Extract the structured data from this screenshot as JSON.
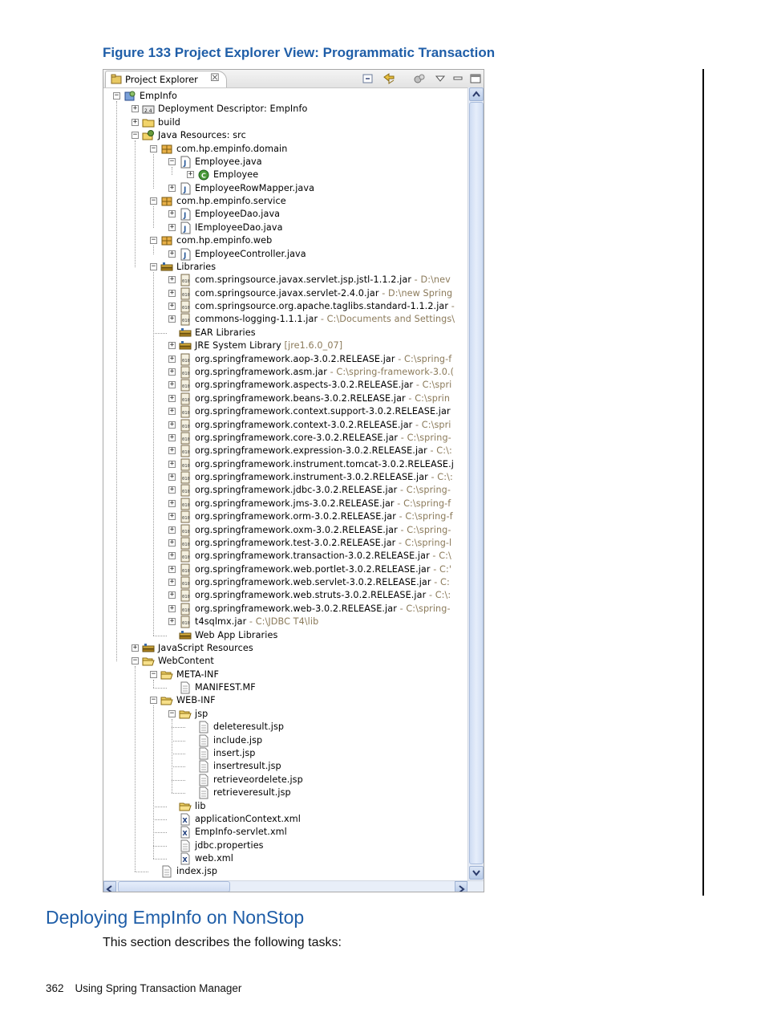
{
  "figure": {
    "caption": "Figure 133 Project Explorer View: Programmatic Transaction"
  },
  "explorer": {
    "tab_label": "Project Explorer",
    "tab_close": "☒",
    "toolbar": [
      "collapse-all-icon",
      "link-with-editor-icon",
      "sync-icon",
      "view-menu-icon",
      "minimize-icon",
      "maximize-icon"
    ],
    "rows": [
      {
        "depth": 0,
        "expand": "minus",
        "icon": "project",
        "label": "EmpInfo"
      },
      {
        "depth": 1,
        "expand": "plus",
        "icon": "descriptor",
        "label": "Deployment Descriptor: EmpInfo"
      },
      {
        "depth": 1,
        "expand": "plus",
        "icon": "folder",
        "label": "build"
      },
      {
        "depth": 1,
        "expand": "minus",
        "icon": "java-resources",
        "label": "Java Resources: src"
      },
      {
        "depth": 2,
        "expand": "minus",
        "icon": "package",
        "label": "com.hp.empinfo.domain"
      },
      {
        "depth": 3,
        "expand": "minus",
        "icon": "java",
        "label": "Employee.java"
      },
      {
        "depth": 4,
        "expand": "plus",
        "icon": "class",
        "label": "Employee"
      },
      {
        "depth": 3,
        "expand": "plus",
        "icon": "java",
        "label": "EmployeeRowMapper.java"
      },
      {
        "depth": 2,
        "expand": "minus",
        "icon": "package",
        "label": "com.hp.empinfo.service"
      },
      {
        "depth": 3,
        "expand": "plus",
        "icon": "java",
        "label": "EmployeeDao.java"
      },
      {
        "depth": 3,
        "expand": "plus",
        "icon": "java",
        "label": "IEmployeeDao.java"
      },
      {
        "depth": 2,
        "expand": "minus",
        "icon": "package",
        "label": "com.hp.empinfo.web"
      },
      {
        "depth": 3,
        "expand": "plus",
        "icon": "java",
        "label": "EmployeeController.java"
      },
      {
        "depth": 2,
        "expand": "minus",
        "icon": "library",
        "label": "Libraries"
      },
      {
        "depth": 3,
        "expand": "plus",
        "icon": "jar",
        "label": "com.springsource.javax.servlet.jsp.jstl-1.1.2.jar",
        "suffix": " - D:\\nev"
      },
      {
        "depth": 3,
        "expand": "plus",
        "icon": "jar",
        "label": "com.springsource.javax.servlet-2.4.0.jar",
        "suffix": " - D:\\new Spring"
      },
      {
        "depth": 3,
        "expand": "plus",
        "icon": "jar",
        "label": "com.springsource.org.apache.taglibs.standard-1.1.2.jar",
        "suffix": " -"
      },
      {
        "depth": 3,
        "expand": "plus",
        "icon": "jar",
        "label": "commons-logging-1.1.1.jar",
        "suffix": " - C:\\Documents and Settings\\"
      },
      {
        "depth": 3,
        "expand": "none",
        "icon": "library",
        "label": "EAR Libraries"
      },
      {
        "depth": 3,
        "expand": "plus",
        "icon": "library",
        "label": "JRE System Library",
        "suffix": " [jre1.6.0_07]"
      },
      {
        "depth": 3,
        "expand": "plus",
        "icon": "jar",
        "label": "org.springframework.aop-3.0.2.RELEASE.jar",
        "suffix": " - C:\\spring-f"
      },
      {
        "depth": 3,
        "expand": "plus",
        "icon": "jar",
        "label": "org.springframework.asm.jar",
        "suffix": " - C:\\spring-framework-3.0.("
      },
      {
        "depth": 3,
        "expand": "plus",
        "icon": "jar",
        "label": "org.springframework.aspects-3.0.2.RELEASE.jar",
        "suffix": " - C:\\spri"
      },
      {
        "depth": 3,
        "expand": "plus",
        "icon": "jar",
        "label": "org.springframework.beans-3.0.2.RELEASE.jar",
        "suffix": " - C:\\sprin"
      },
      {
        "depth": 3,
        "expand": "plus",
        "icon": "jar",
        "label": "org.springframework.context.support-3.0.2.RELEASE.jar",
        "suffix": ""
      },
      {
        "depth": 3,
        "expand": "plus",
        "icon": "jar",
        "label": "org.springframework.context-3.0.2.RELEASE.jar",
        "suffix": " - C:\\spri"
      },
      {
        "depth": 3,
        "expand": "plus",
        "icon": "jar",
        "label": "org.springframework.core-3.0.2.RELEASE.jar",
        "suffix": " - C:\\spring-"
      },
      {
        "depth": 3,
        "expand": "plus",
        "icon": "jar",
        "label": "org.springframework.expression-3.0.2.RELEASE.jar",
        "suffix": " - C:\\:"
      },
      {
        "depth": 3,
        "expand": "plus",
        "icon": "jar",
        "label": "org.springframework.instrument.tomcat-3.0.2.RELEASE.j",
        "suffix": ""
      },
      {
        "depth": 3,
        "expand": "plus",
        "icon": "jar",
        "label": "org.springframework.instrument-3.0.2.RELEASE.jar",
        "suffix": " - C:\\:"
      },
      {
        "depth": 3,
        "expand": "plus",
        "icon": "jar",
        "label": "org.springframework.jdbc-3.0.2.RELEASE.jar",
        "suffix": " - C:\\spring-"
      },
      {
        "depth": 3,
        "expand": "plus",
        "icon": "jar",
        "label": "org.springframework.jms-3.0.2.RELEASE.jar",
        "suffix": " - C:\\spring-f"
      },
      {
        "depth": 3,
        "expand": "plus",
        "icon": "jar",
        "label": "org.springframework.orm-3.0.2.RELEASE.jar",
        "suffix": " - C:\\spring-f"
      },
      {
        "depth": 3,
        "expand": "plus",
        "icon": "jar",
        "label": "org.springframework.oxm-3.0.2.RELEASE.jar",
        "suffix": " - C:\\spring-"
      },
      {
        "depth": 3,
        "expand": "plus",
        "icon": "jar",
        "label": "org.springframework.test-3.0.2.RELEASE.jar",
        "suffix": " - C:\\spring-l"
      },
      {
        "depth": 3,
        "expand": "plus",
        "icon": "jar",
        "label": "org.springframework.transaction-3.0.2.RELEASE.jar",
        "suffix": " - C:\\"
      },
      {
        "depth": 3,
        "expand": "plus",
        "icon": "jar",
        "label": "org.springframework.web.portlet-3.0.2.RELEASE.jar",
        "suffix": " - C:'"
      },
      {
        "depth": 3,
        "expand": "plus",
        "icon": "jar",
        "label": "org.springframework.web.servlet-3.0.2.RELEASE.jar",
        "suffix": " - C:"
      },
      {
        "depth": 3,
        "expand": "plus",
        "icon": "jar",
        "label": "org.springframework.web.struts-3.0.2.RELEASE.jar",
        "suffix": " - C:\\:"
      },
      {
        "depth": 3,
        "expand": "plus",
        "icon": "jar",
        "label": "org.springframework.web-3.0.2.RELEASE.jar",
        "suffix": " - C:\\spring-"
      },
      {
        "depth": 3,
        "expand": "plus",
        "icon": "jar",
        "label": "t4sqlmx.jar",
        "suffix": " - C:\\JDBC T4\\lib"
      },
      {
        "depth": 3,
        "expand": "none",
        "icon": "library",
        "label": "Web App Libraries"
      },
      {
        "depth": 1,
        "expand": "plus",
        "icon": "library",
        "label": "JavaScript Resources"
      },
      {
        "depth": 1,
        "expand": "minus",
        "icon": "folder-open",
        "label": "WebContent"
      },
      {
        "depth": 2,
        "expand": "minus",
        "icon": "folder-open",
        "label": "META-INF"
      },
      {
        "depth": 3,
        "expand": "none",
        "icon": "file",
        "label": "MANIFEST.MF"
      },
      {
        "depth": 2,
        "expand": "minus",
        "icon": "folder-open",
        "label": "WEB-INF"
      },
      {
        "depth": 3,
        "expand": "minus",
        "icon": "folder-open",
        "label": "jsp"
      },
      {
        "depth": 4,
        "expand": "none",
        "icon": "file",
        "label": "deleteresult.jsp"
      },
      {
        "depth": 4,
        "expand": "none",
        "icon": "file",
        "label": "include.jsp"
      },
      {
        "depth": 4,
        "expand": "none",
        "icon": "file",
        "label": "insert.jsp"
      },
      {
        "depth": 4,
        "expand": "none",
        "icon": "file",
        "label": "insertresult.jsp"
      },
      {
        "depth": 4,
        "expand": "none",
        "icon": "file",
        "label": "retrieveordelete.jsp"
      },
      {
        "depth": 4,
        "expand": "none",
        "icon": "file",
        "label": "retrieveresult.jsp"
      },
      {
        "depth": 3,
        "expand": "none",
        "icon": "folder-open",
        "label": "lib"
      },
      {
        "depth": 3,
        "expand": "none",
        "icon": "xml",
        "label": "applicationContext.xml"
      },
      {
        "depth": 3,
        "expand": "none",
        "icon": "xml",
        "label": "EmpInfo-servlet.xml"
      },
      {
        "depth": 3,
        "expand": "none",
        "icon": "file",
        "label": "jdbc.properties"
      },
      {
        "depth": 3,
        "expand": "none",
        "icon": "xml",
        "label": "web.xml"
      },
      {
        "depth": 2,
        "expand": "none",
        "icon": "file",
        "label": "index.jsp"
      }
    ]
  },
  "section": {
    "heading": "Deploying EmpInfo on NonStop",
    "intro": "This section describes the following tasks:"
  },
  "footer": {
    "page_number": "362",
    "running_title": "Using Spring Transaction Manager"
  }
}
